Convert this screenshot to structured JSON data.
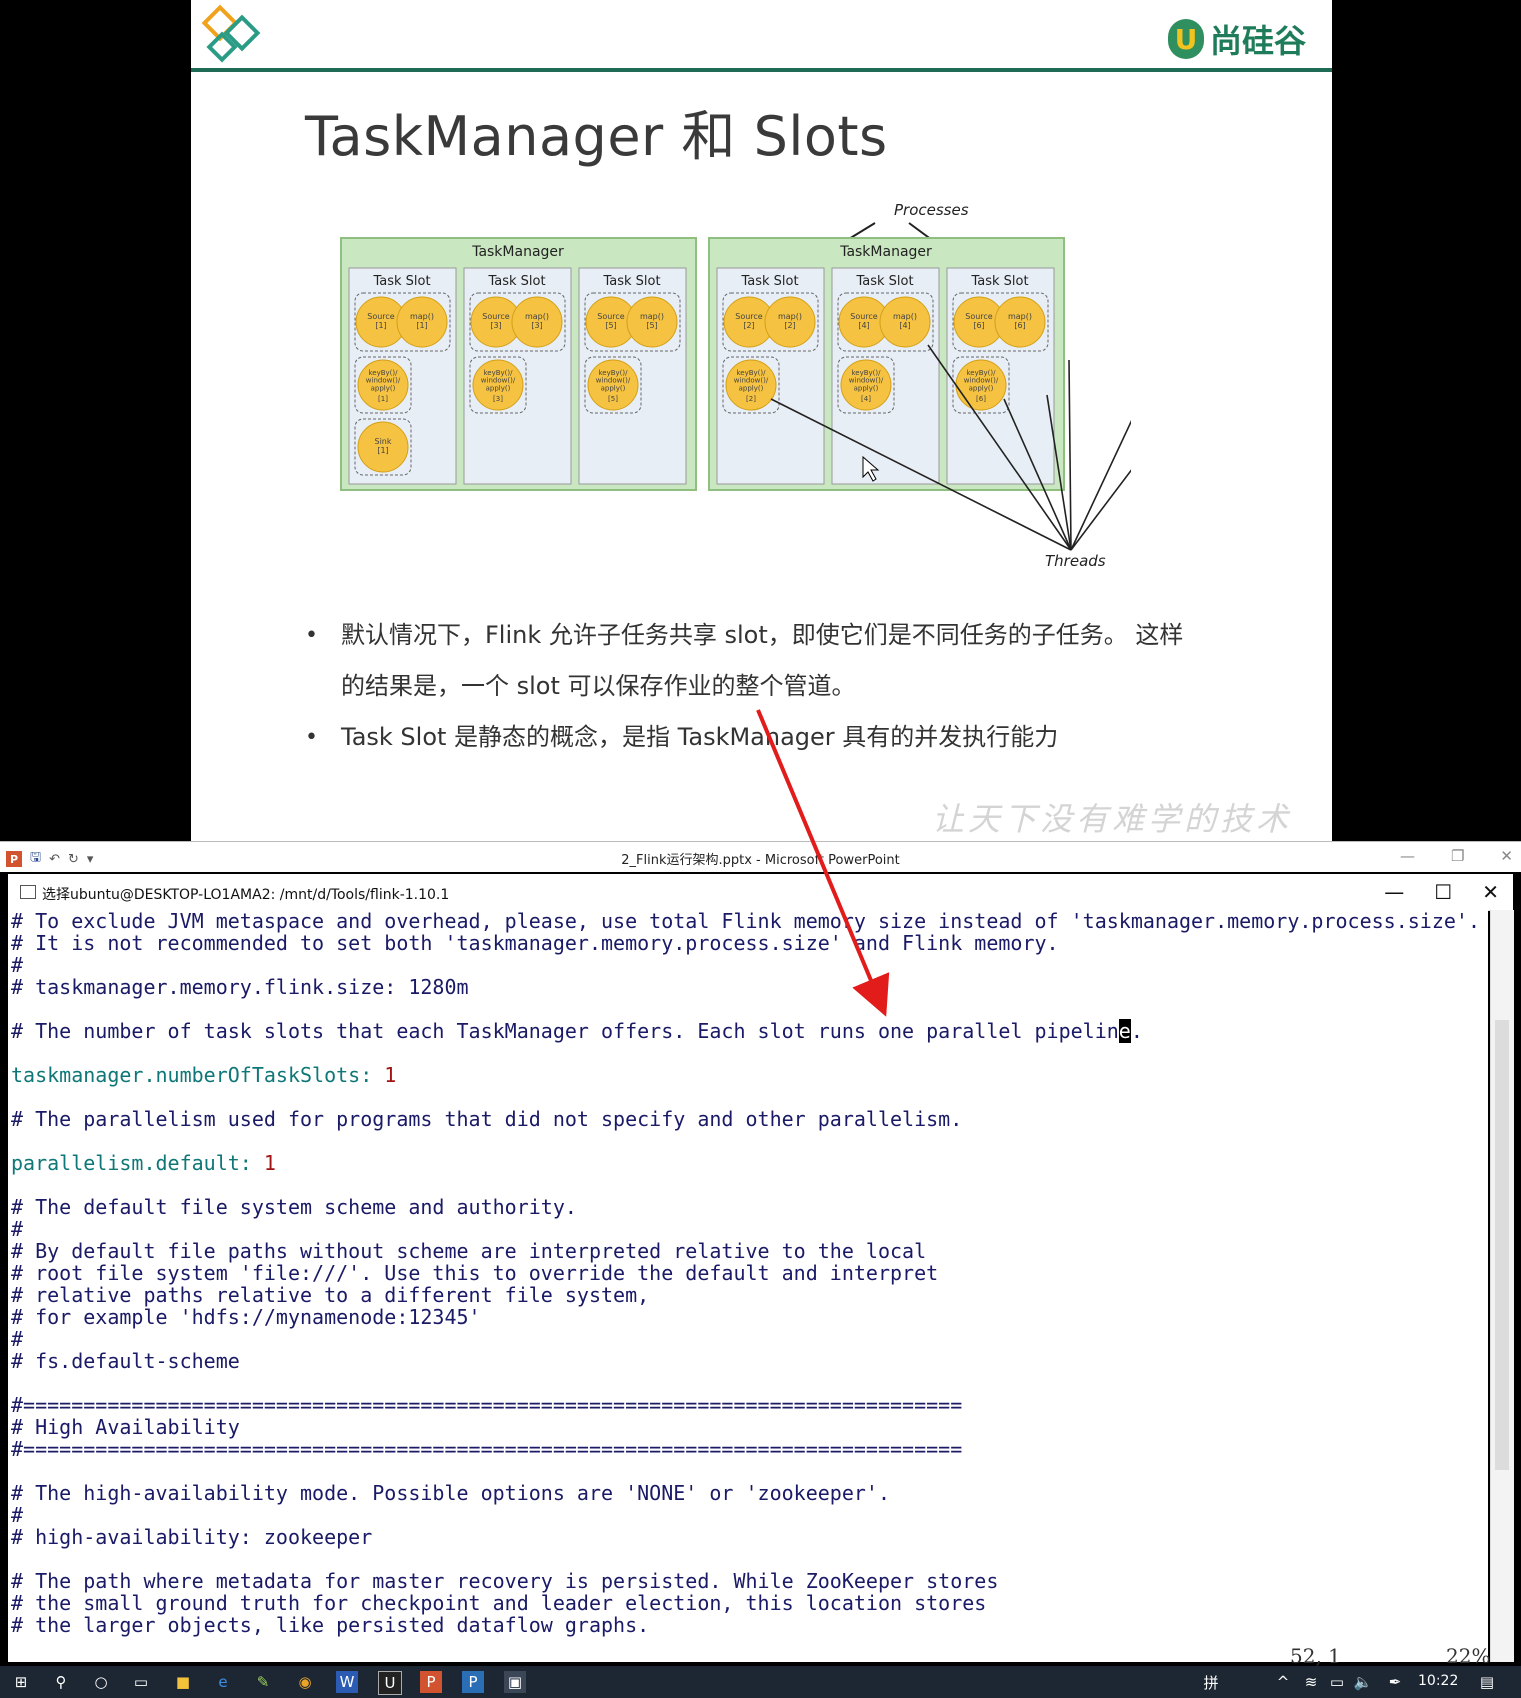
{
  "slide": {
    "brand_name": "尚硅谷",
    "brand_letter": "U",
    "title": "TaskManager 和 Slots",
    "diagram": {
      "processes_label": "Processes",
      "threads_label": "Threads",
      "task_manager_label": "TaskManager",
      "task_slot_label": "Task Slot",
      "source_labels": [
        "Source\n[1]",
        "Source\n[3]",
        "Source\n[5]",
        "Source\n[2]",
        "Source\n[4]",
        "Source\n[6]"
      ],
      "map_labels": [
        "map()\n[1]",
        "map()\n[3]",
        "map()\n[5]",
        "map()\n[2]",
        "map()\n[4]",
        "map()\n[6]"
      ],
      "keyby_labels": [
        "[1]",
        "[3]",
        "[5]",
        "[2]",
        "[4]",
        "[6]"
      ],
      "keyby_text": "keyBy()/\nwindow()/\napply()",
      "sink_label": "Sink\n[1]"
    },
    "bullets": [
      "默认情况下，Flink 允许子任务共享 slot，即使它们是不同任务的子任务。 这样",
      "的结果是，一个 slot 可以保存作业的整个管道。",
      "Task Slot 是静态的概念，是指 TaskManager 具有的并发执行能力"
    ],
    "slogan": "让天下没有难学的技术",
    "colors": {
      "header_line": "#1f6b55",
      "tm_fill": "#c9e7c0",
      "slot_fill": "#e8eef5",
      "circle": "#f5c242"
    }
  },
  "powerpoint": {
    "title": "2_Flink运行架构.pptx  -  Microsoft PowerPoint",
    "icon_letter": "P"
  },
  "terminal": {
    "title": "选择ubuntu@DESKTOP-LO1AMA2: /mnt/d/Tools/flink-1.10.1",
    "lines": [
      {
        "text": "# To exclude JVM metaspace and overhead, please, use total Flink memory size instead of 'taskmanager.memory.process.size'.",
        "kind": "comment"
      },
      {
        "text": "# It is not recommended to set both 'taskmanager.memory.process.size' and Flink memory.",
        "kind": "comment"
      },
      {
        "text": "#",
        "kind": "comment"
      },
      {
        "text": "# taskmanager.memory.flink.size: 1280m",
        "kind": "comment"
      },
      {
        "text": "",
        "kind": "blank"
      },
      {
        "text": "# The number of task slots that each TaskManager offers. Each slot runs one parallel pipeline.",
        "kind": "comment"
      },
      {
        "text": "",
        "kind": "blank"
      },
      {
        "text": "taskmanager.numberOfTaskSlots: ",
        "value": "1",
        "kind": "key"
      },
      {
        "text": "",
        "kind": "blank"
      },
      {
        "text": "# The parallelism used for programs that did not specify and other parallelism.",
        "kind": "comment"
      },
      {
        "text": "",
        "kind": "blank"
      },
      {
        "text": "parallelism.default: ",
        "value": "1",
        "kind": "key"
      },
      {
        "text": "",
        "kind": "blank"
      },
      {
        "text": "# The default file system scheme and authority.",
        "kind": "comment"
      },
      {
        "text": "#",
        "kind": "comment"
      },
      {
        "text": "# By default file paths without scheme are interpreted relative to the local",
        "kind": "comment"
      },
      {
        "text": "# root file system 'file:///'. Use this to override the default and interpret",
        "kind": "comment"
      },
      {
        "text": "# relative paths relative to a different file system,",
        "kind": "comment"
      },
      {
        "text": "# for example 'hdfs://mynamenode:12345'",
        "kind": "comment"
      },
      {
        "text": "#",
        "kind": "comment"
      },
      {
        "text": "# fs.default-scheme",
        "kind": "comment"
      },
      {
        "text": "",
        "kind": "blank"
      },
      {
        "text": "#==============================================================================",
        "kind": "comment"
      },
      {
        "text": "# High Availability",
        "kind": "comment"
      },
      {
        "text": "#==============================================================================",
        "kind": "comment"
      },
      {
        "text": "",
        "kind": "blank"
      },
      {
        "text": "# The high-availability mode. Possible options are 'NONE' or 'zookeeper'.",
        "kind": "comment"
      },
      {
        "text": "#",
        "kind": "comment"
      },
      {
        "text": "# high-availability: zookeeper",
        "kind": "comment"
      },
      {
        "text": "",
        "kind": "blank"
      },
      {
        "text": "# The path where metadata for master recovery is persisted. While ZooKeeper stores",
        "kind": "comment"
      },
      {
        "text": "# the small ground truth for checkpoint and leader election, this location stores",
        "kind": "comment"
      },
      {
        "text": "# the larger objects, like persisted dataflow graphs.",
        "kind": "comment"
      }
    ],
    "cursor_position": "52, 1",
    "scroll_percent": "22%"
  },
  "taskbar": {
    "clock": "10:22",
    "apps": [
      "start-icon",
      "search-icon",
      "cortana-icon",
      "task-view-icon",
      "file-explorer-icon",
      "edge-icon",
      "notepad-icon",
      "chrome-icon",
      "word-icon",
      "ubuntu-icon",
      "powerpoint-icon",
      "publisher-icon",
      "terminal-icon"
    ]
  }
}
